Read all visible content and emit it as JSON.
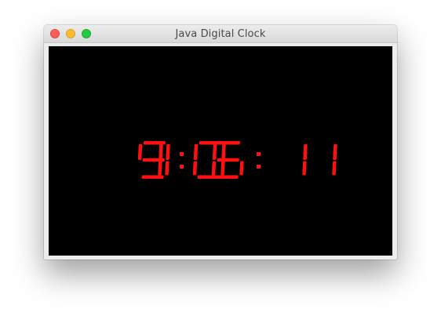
{
  "window": {
    "title": "Java Digital Clock",
    "buttons": {
      "close": "close-button",
      "minimize": "minimize-button",
      "zoom": "zoom-button"
    }
  },
  "clock": {
    "time": "19:06: 11",
    "hours": "19",
    "minutes": "06",
    "seconds": "11",
    "digit_color": "#ff1010",
    "background_color": "#000000"
  },
  "colors": {
    "close": "#fc5f57",
    "minimize": "#fdbc2e",
    "zoom": "#28c840"
  }
}
